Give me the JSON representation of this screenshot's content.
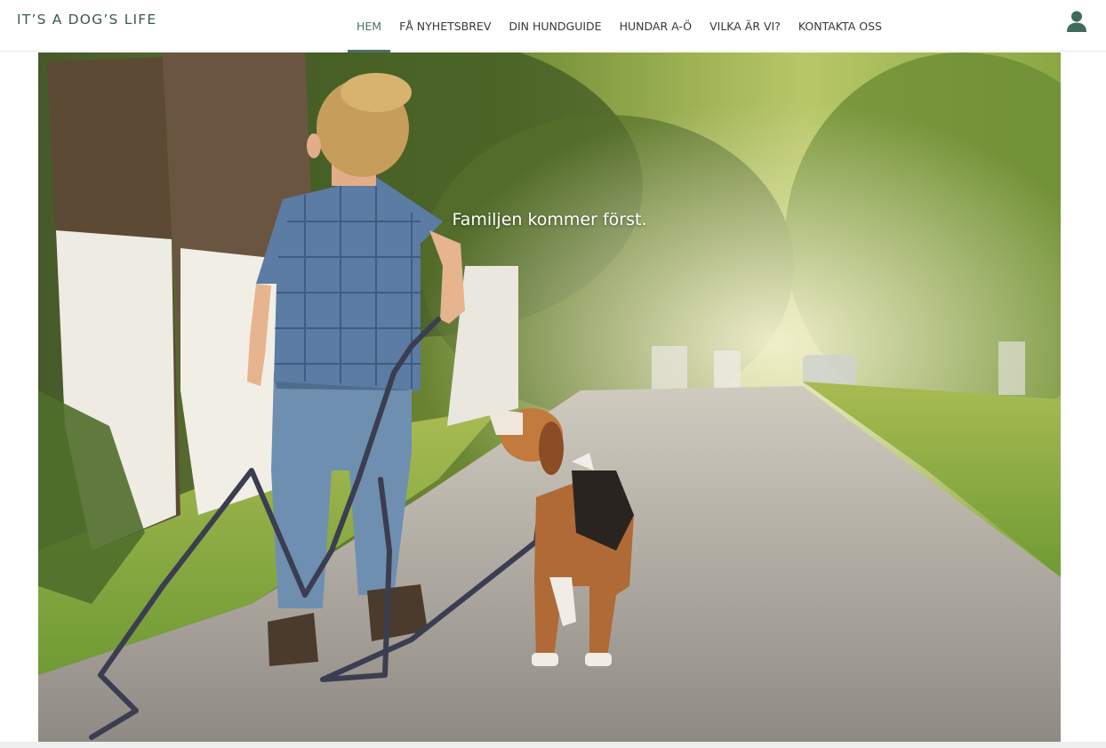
{
  "header": {
    "brand": "IT’S A DOG’S LIFE",
    "nav": [
      {
        "label": "HEM",
        "active": true
      },
      {
        "label": "FÅ NYHETSBREV",
        "active": false
      },
      {
        "label": "DIN HUNDGUIDE",
        "active": false
      },
      {
        "label": "HUNDAR A-Ö",
        "active": false
      },
      {
        "label": "VILKA ÄR VI?",
        "active": false
      },
      {
        "label": "KONTAKTA OSS",
        "active": false
      }
    ],
    "user_icon": "user-account-icon"
  },
  "hero": {
    "tagline": "Familjen kommer först.",
    "image": "boy-walking-beagle-photo"
  },
  "colors": {
    "accent": "#4d7163",
    "brand_text": "#3c5a4d",
    "nav_text": "#333a37"
  }
}
